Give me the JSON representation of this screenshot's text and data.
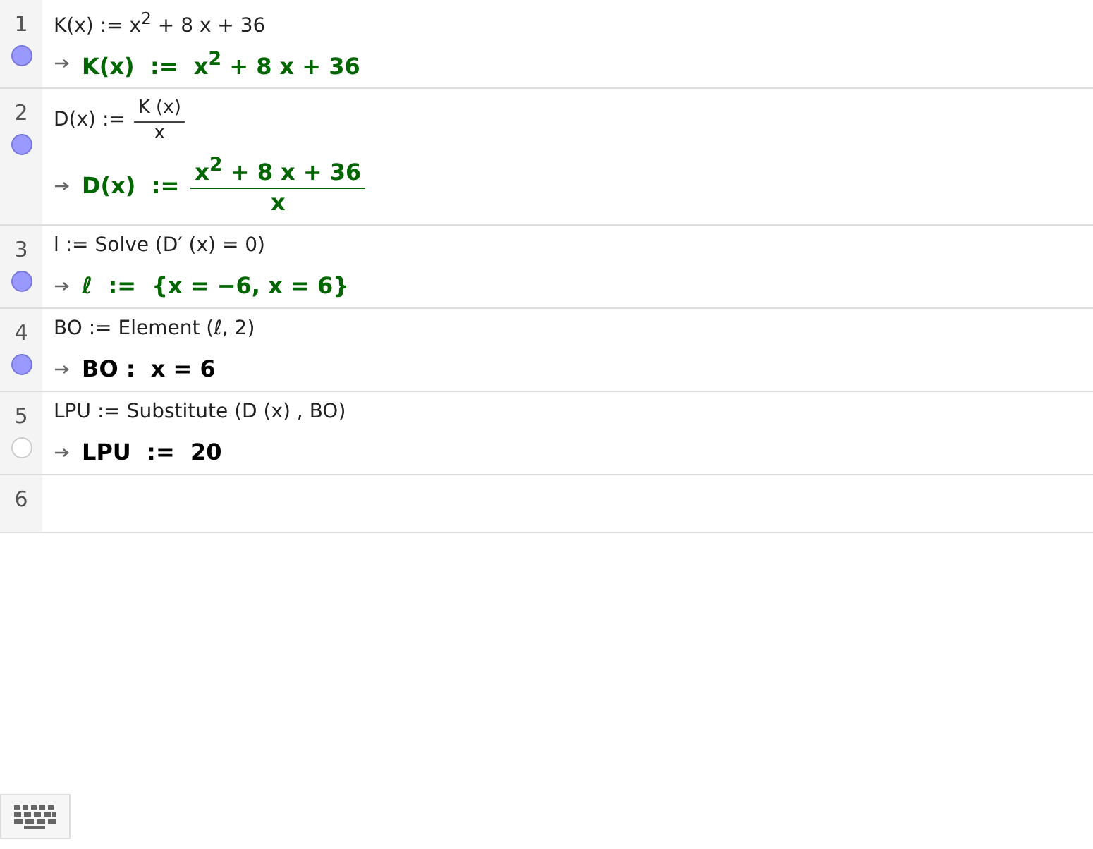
{
  "rows": [
    {
      "number": "1",
      "visible": true,
      "input": {
        "kind": "text",
        "text": "K(x) := x$^{2}$ + 8 x + 36"
      },
      "output": {
        "kind": "text",
        "text": "K(x)  :=  x$^{2}$ + 8 x + 36",
        "color": "#006600"
      }
    },
    {
      "number": "2",
      "visible": true,
      "input": {
        "kind": "fraction",
        "lhs": "D(x) :=",
        "num": "K (x)",
        "den": "x"
      },
      "output": {
        "kind": "fraction",
        "lhs": "D(x)  :=",
        "num": "x$^{2}$ + 8 x + 36",
        "den": "x",
        "color": "#006600"
      }
    },
    {
      "number": "3",
      "visible": true,
      "input": {
        "kind": "text",
        "text": "l := Solve (D′ (x) = 0)"
      },
      "output": {
        "kind": "text",
        "text": "*ℓ*  :=  {x = −6, x = 6}",
        "color": "#006600"
      }
    },
    {
      "number": "4",
      "visible": true,
      "input": {
        "kind": "text",
        "text": "BO := Element (ℓ, 2)"
      },
      "output": {
        "kind": "text",
        "text": "BO :  x = 6",
        "color": "#000000"
      }
    },
    {
      "number": "5",
      "visible": false,
      "input": {
        "kind": "text",
        "text": "LPU := Substitute (D (x) , BO)"
      },
      "output": {
        "kind": "text",
        "text": "LPU  :=  20",
        "color": "#000000"
      }
    },
    {
      "number": "6"
    }
  ]
}
